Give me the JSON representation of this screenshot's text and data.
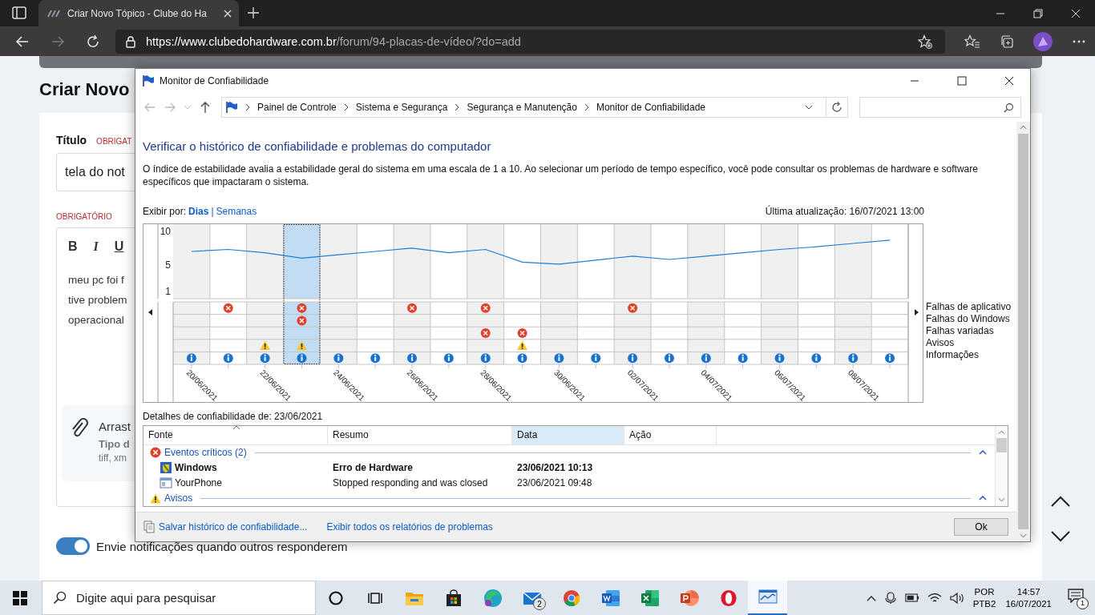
{
  "browser": {
    "tab": {
      "title": "Criar Novo Tópico - Clube do Ha",
      "selected": true
    },
    "url": {
      "host": "https://www.clubedohardware.com.br",
      "path": "/forum/94-placas-de-vídeo/?do=add"
    }
  },
  "page": {
    "heading": "Criar Novo",
    "title_label": "Título",
    "title_required": "OBRIGAT",
    "title_value": "tela do not",
    "body_required": "OBRIGATÓRIO",
    "toolbar": [
      "B",
      "I",
      "U"
    ],
    "body_lines": [
      "meu pc foi f",
      "tive problem",
      "operacional"
    ],
    "attach": {
      "title": "Arrast",
      "type": "Tipo d",
      "formats": "tiff, xm"
    },
    "notify": {
      "label": "Envie notificações quando outros responderem",
      "on": true
    }
  },
  "window": {
    "title": "Monitor de Confiabilidade",
    "breadcrumb": [
      "Painel de Controle",
      "Sistema e Segurança",
      "Segurança e Manutenção",
      "Monitor de Confiabilidade"
    ],
    "heading": "Verificar o histórico de confiabilidade e problemas do computador",
    "description": "O índice de estabilidade avalia a estabilidade geral do sistema em uma escala de 1 a 10. Ao selecionar um período de tempo específico, você pode consultar os problemas de hardware e software específicos que impactaram o sistema.",
    "view_by": {
      "label": "Exibir por:",
      "separator": "|",
      "options": [
        {
          "label": "Dias",
          "selected": true
        },
        {
          "label": "Semanas",
          "selected": false
        }
      ]
    },
    "last_update": "Última atualização: 16/07/2021 13:00",
    "chart": {
      "chart_data": {
        "type": "line",
        "categories": [
          null,
          null,
          null,
          null,
          null,
          null,
          null,
          null,
          null,
          null,
          null,
          null,
          null,
          null,
          null,
          null,
          null,
          null,
          null,
          null
        ],
        "series": [
          {
            "color": "#1e7fd8",
            "values": [
              7.0,
              7.3,
              6.8,
              6.0,
              6.5,
              7.0,
              7.5,
              6.8,
              7.3,
              5.4,
              5.1,
              5.7,
              6.3,
              5.8,
              6.3,
              6.8,
              7.3,
              7.7,
              8.2,
              8.7
            ]
          }
        ],
        "ylim": [
          1,
          10
        ],
        "yticks": [
          10,
          5,
          1
        ]
      },
      "days": [
        {
          "label": "20/06/2021",
          "selected": false,
          "app": false,
          "windows": false,
          "misc": false,
          "warning": false,
          "info": true
        },
        {
          "selected": false,
          "app": true,
          "windows": false,
          "misc": false,
          "warning": false,
          "info": true
        },
        {
          "label": "22/06/2021",
          "selected": false,
          "app": false,
          "windows": false,
          "misc": false,
          "warning": true,
          "info": true
        },
        {
          "selected": true,
          "app": true,
          "windows": true,
          "misc": false,
          "warning": true,
          "info": true
        },
        {
          "label": "24/06/2021",
          "selected": false,
          "app": false,
          "windows": false,
          "misc": false,
          "warning": false,
          "info": true
        },
        {
          "selected": false,
          "app": false,
          "windows": false,
          "misc": false,
          "warning": false,
          "info": true
        },
        {
          "label": "26/06/2021",
          "selected": false,
          "app": true,
          "windows": false,
          "misc": false,
          "warning": false,
          "info": true
        },
        {
          "selected": false,
          "app": false,
          "windows": false,
          "misc": false,
          "warning": false,
          "info": true
        },
        {
          "label": "28/06/2021",
          "selected": false,
          "app": true,
          "windows": false,
          "misc": true,
          "warning": false,
          "info": true
        },
        {
          "selected": false,
          "app": false,
          "windows": false,
          "misc": true,
          "warning": true,
          "info": true
        },
        {
          "label": "30/06/2021",
          "selected": false,
          "app": false,
          "windows": false,
          "misc": false,
          "warning": false,
          "info": true
        },
        {
          "selected": false,
          "app": false,
          "windows": false,
          "misc": false,
          "warning": false,
          "info": true
        },
        {
          "label": "02/07/2021",
          "selected": false,
          "app": true,
          "windows": false,
          "misc": false,
          "warning": false,
          "info": true
        },
        {
          "selected": false,
          "app": false,
          "windows": false,
          "misc": false,
          "warning": false,
          "info": true
        },
        {
          "label": "04/07/2021",
          "selected": false,
          "app": false,
          "windows": false,
          "misc": false,
          "warning": false,
          "info": true
        },
        {
          "selected": false,
          "app": false,
          "windows": false,
          "misc": false,
          "warning": false,
          "info": true
        },
        {
          "label": "06/07/2021",
          "selected": false,
          "app": false,
          "windows": false,
          "misc": false,
          "warning": false,
          "info": true
        },
        {
          "selected": false,
          "app": false,
          "windows": false,
          "misc": false,
          "warning": false,
          "info": true
        },
        {
          "label": "08/07/2021",
          "selected": false,
          "app": false,
          "windows": false,
          "misc": false,
          "warning": false,
          "info": true
        },
        {
          "selected": false,
          "app": false,
          "windows": false,
          "misc": false,
          "warning": false,
          "info": true
        }
      ],
      "legend": [
        "Falhas de aplicativo",
        "Falhas do Windows",
        "Falhas variadas",
        "Avisos",
        "Informações"
      ]
    },
    "details_title": "Detalhes de confiabilidade de: 23/06/2021",
    "table": {
      "columns": [
        {
          "label": "Fonte",
          "selected": false
        },
        {
          "label": "Resumo",
          "selected": false
        },
        {
          "label": "Data",
          "selected": true
        },
        {
          "label": "Ação",
          "selected": false
        }
      ],
      "groups": [
        {
          "title": "Eventos críticos (2)",
          "kind": "critical",
          "expanded": true,
          "rows": [
            {
              "kind": "windows",
              "unread": true,
              "source": "Windows",
              "summary": "Erro de Hardware",
              "date": "23/06/2021 10:13"
            },
            {
              "kind": "app",
              "unread": false,
              "source": "YourPhone",
              "summary": "Stopped responding and was closed",
              "date": "23/06/2021 09:48"
            }
          ]
        },
        {
          "title": "Avisos",
          "kind": "warning",
          "expanded": true
        }
      ]
    },
    "links": [
      "Salvar histórico de confiabilidade...",
      "Exibir todos os relatórios de problemas"
    ],
    "ok_button": "Ok"
  },
  "taskbar": {
    "search_placeholder": "Digite aqui para pesquisar",
    "apps": [
      {
        "kind": "cortana",
        "active": false
      },
      {
        "kind": "taskview",
        "active": false
      },
      {
        "kind": "explorer",
        "active": false
      },
      {
        "kind": "store",
        "active": false
      },
      {
        "kind": "edge",
        "active": false
      },
      {
        "kind": "mail",
        "active": false,
        "badge": "2"
      },
      {
        "kind": "chrome",
        "active": false
      },
      {
        "kind": "word",
        "active": false
      },
      {
        "kind": "excel",
        "active": false
      },
      {
        "kind": "powerpoint",
        "active": false
      },
      {
        "kind": "opera",
        "active": false
      },
      {
        "kind": "monitor",
        "active": true
      }
    ],
    "language": [
      "POR",
      "PTB2"
    ],
    "time": "14:57",
    "date": "16/07/2021",
    "notifications": "1"
  }
}
